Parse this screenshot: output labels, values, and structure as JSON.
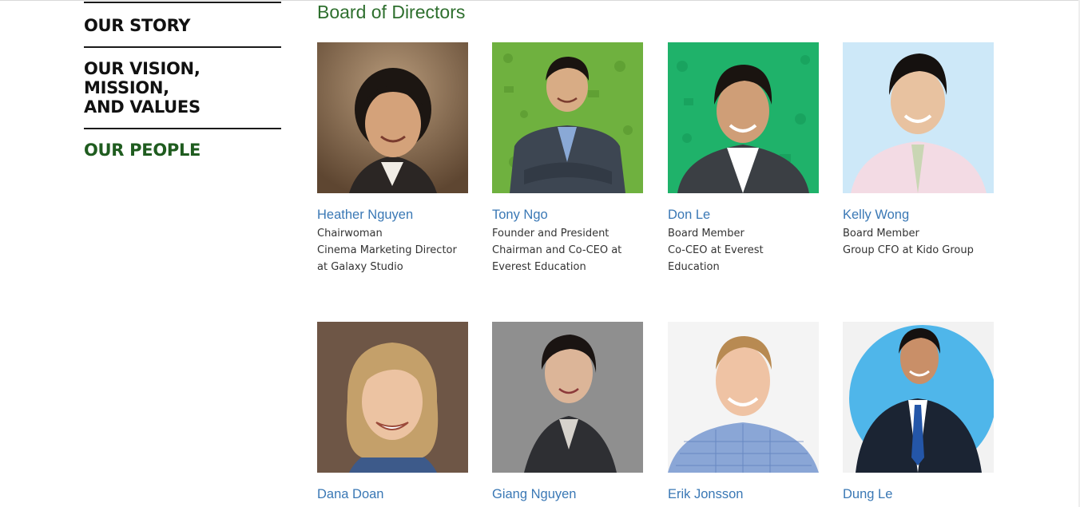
{
  "nav": {
    "items": [
      {
        "label": "OUR STORY"
      },
      {
        "label": "OUR VISION, MISSION,\nAND VALUES"
      },
      {
        "label": "OUR PEOPLE"
      }
    ]
  },
  "section": {
    "title": "Board of Directors"
  },
  "people": [
    {
      "name": "Heather Nguyen",
      "lines": [
        "Chairwoman",
        "Cinema Marketing Director",
        "at Galaxy Studio"
      ]
    },
    {
      "name": "Tony Ngo",
      "lines": [
        "Founder and President",
        "Chairman and Co-CEO at",
        "Everest Education"
      ]
    },
    {
      "name": "Don Le",
      "lines": [
        "Board Member",
        "Co-CEO at Everest",
        "Education"
      ]
    },
    {
      "name": "Kelly Wong",
      "lines": [
        "Board Member",
        "Group CFO at Kido Group"
      ]
    },
    {
      "name": "Dana Doan",
      "lines": []
    },
    {
      "name": "Giang Nguyen",
      "lines": []
    },
    {
      "name": "Erik Jonsson",
      "lines": []
    },
    {
      "name": "Dung Le",
      "lines": []
    }
  ],
  "colors": {
    "accent_green": "#2e6f2e",
    "nav_active": "#1f5c1f",
    "link_blue": "#3a78b5"
  }
}
